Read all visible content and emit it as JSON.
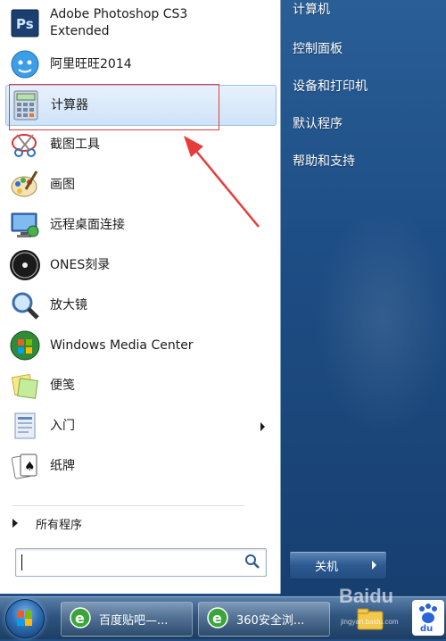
{
  "start_menu": {
    "programs": [
      {
        "label": "Adobe Photoshop CS3\nExtended",
        "icon": "photoshop-icon"
      },
      {
        "label": "阿里旺旺2014",
        "icon": "aliwangwang-icon"
      },
      {
        "label": "计算器",
        "icon": "calculator-icon",
        "selected": true
      },
      {
        "label": "截图工具",
        "icon": "snipping-tool-icon"
      },
      {
        "label": "画图",
        "icon": "paint-icon"
      },
      {
        "label": "远程桌面连接",
        "icon": "remote-desktop-icon"
      },
      {
        "label": "ONES刻录",
        "icon": "ones-burner-icon"
      },
      {
        "label": "放大镜",
        "icon": "magnifier-icon"
      },
      {
        "label": "Windows Media Center",
        "icon": "media-center-icon"
      },
      {
        "label": "便笺",
        "icon": "sticky-notes-icon"
      },
      {
        "label": "入门",
        "icon": "getting-started-icon",
        "has_submenu": true
      },
      {
        "label": "纸牌",
        "icon": "solitaire-icon"
      }
    ],
    "all_programs_label": "所有程序",
    "search_placeholder": "",
    "right_items": [
      "计算机",
      "控制面板",
      "设备和打印机",
      "默认程序",
      "帮助和支持"
    ],
    "shutdown_label": "关机"
  },
  "taskbar": {
    "buttons": [
      {
        "label": "百度贴吧—...",
        "icon": "ie-icon"
      },
      {
        "label": "360安全浏...",
        "icon": "ie-icon"
      }
    ]
  },
  "watermark": {
    "text": "Baidu",
    "sub": "jingyan.baidu.com"
  },
  "colors": {
    "highlight_box": "#e83b3b",
    "accent": "#1f4f86"
  }
}
